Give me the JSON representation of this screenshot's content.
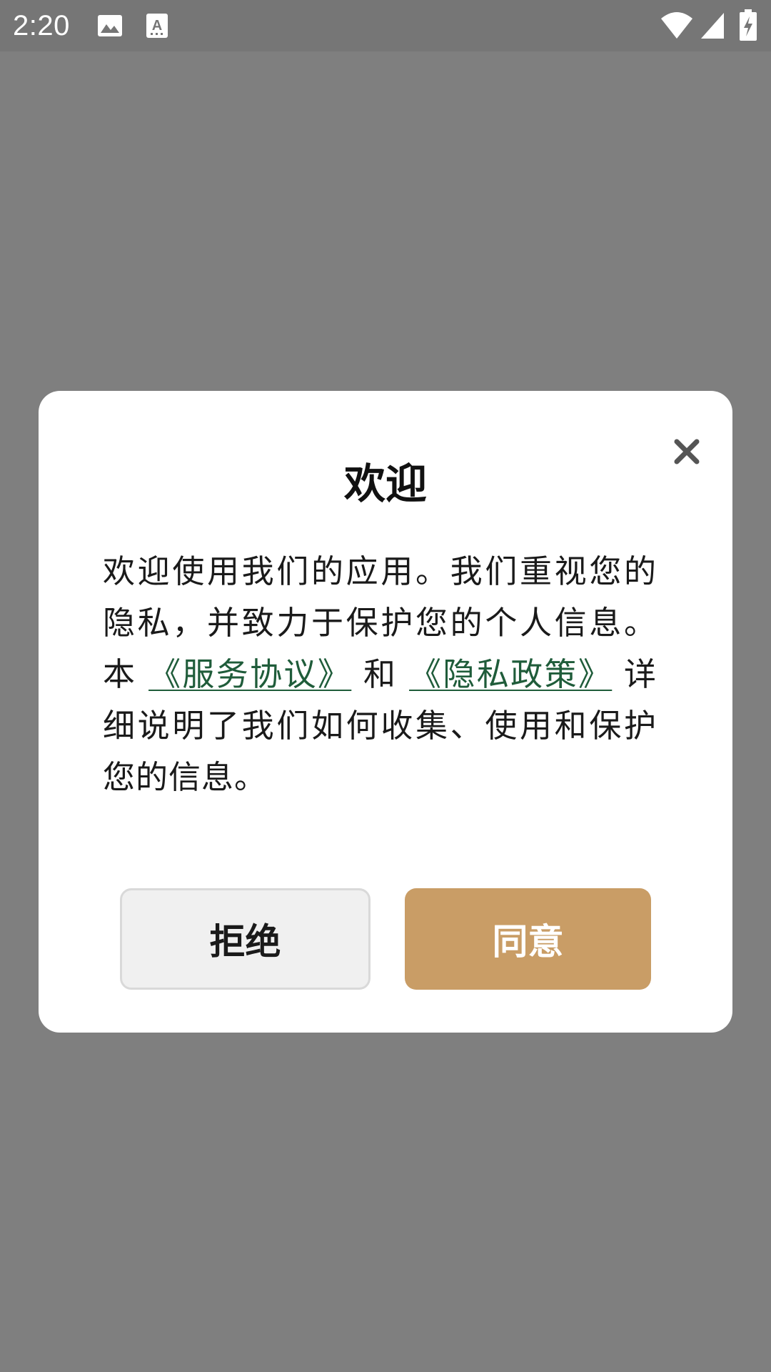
{
  "status_bar": {
    "time": "2:20",
    "icons": [
      "image-notification-icon",
      "text-notification-icon",
      "wifi-icon",
      "cellular-signal-icon",
      "battery-charging-icon"
    ]
  },
  "dialog": {
    "title": "欢迎",
    "body": {
      "intro": "欢迎使用我们的应用。我们重视您的隐私，并致力于保护您的个人信息。本",
      "terms_link": "《服务协议》",
      "conjunction": "和",
      "privacy_link": "《隐私政策》",
      "outro": "详细说明了我们如何收集、使用和保护您的信息。"
    },
    "reject_label": "拒绝",
    "agree_label": "同意",
    "close_icon": "close-icon"
  },
  "colors": {
    "overlay": "#7f7f7f",
    "link": "#1f5c3a",
    "agree_button": "#c99d66",
    "reject_button": "#f0f0f0"
  }
}
